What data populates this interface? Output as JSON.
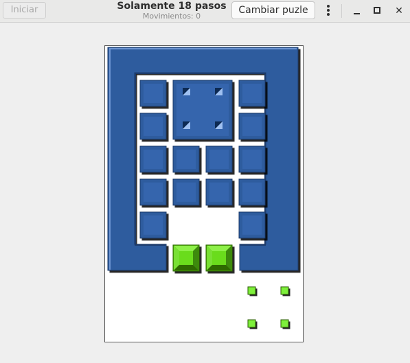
{
  "header": {
    "start_label": "Iniciar",
    "title": "Solamente 18 pasos",
    "moves_text": "Movimientos: 0",
    "change_label": "Cambiar puzle"
  },
  "icons": [
    "menu-icon",
    "minimize-icon",
    "maximize-icon",
    "close-icon"
  ],
  "colors": {
    "block": "#2f5b9e",
    "goal_block": "#6bdc1a",
    "target_marker": "#7ef03a"
  }
}
